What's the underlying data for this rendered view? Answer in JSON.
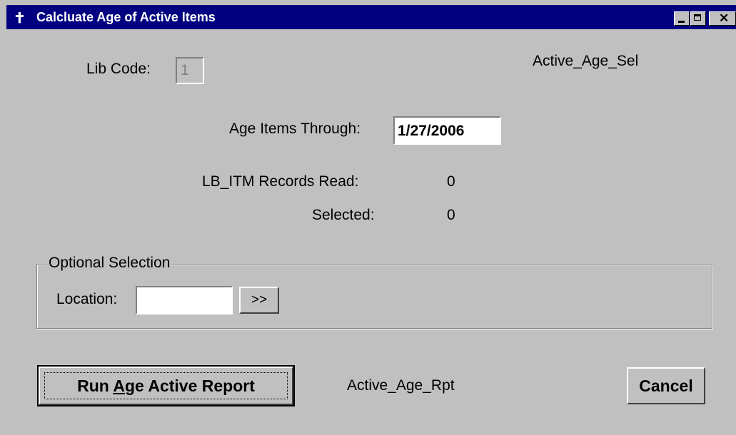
{
  "window": {
    "title": "Calcluate Age of Active Items",
    "icon": "arrow-cursor-icon"
  },
  "form": {
    "lib_code_label": "Lib Code:",
    "lib_code_value": "1",
    "form_name": "Active_Age_Sel",
    "age_through_label": "Age Items Through:",
    "age_through_value": "1/27/2006",
    "records_read_label": "LB_ITM Records Read:",
    "records_read_value": "0",
    "selected_label": "Selected:",
    "selected_value": "0"
  },
  "optional": {
    "legend": "Optional Selection",
    "location_label": "Location:",
    "location_value": "",
    "lookup_button": ">>"
  },
  "actions": {
    "run_prefix": "Run ",
    "run_accel": "A",
    "run_suffix": "ge Active Report",
    "report_name": "Active_Age_Rpt",
    "cancel": "Cancel"
  }
}
